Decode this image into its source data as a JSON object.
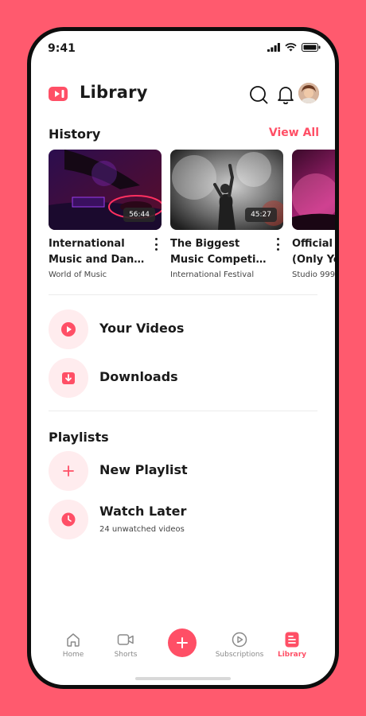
{
  "status_bar": {
    "time": "9:41"
  },
  "header": {
    "title": "Library"
  },
  "history": {
    "title": "History",
    "view_all": "View All",
    "videos": [
      {
        "title_line1": "International",
        "title_line2": "Music and Dance…",
        "channel": "World of Music",
        "duration": "56:44"
      },
      {
        "title_line1": "The Biggest",
        "title_line2": "Music Competiti…",
        "channel": "International Festival",
        "duration": "45:27"
      },
      {
        "title_line1": "Official",
        "title_line2": "(Only Yo",
        "channel": "Studio 999",
        "duration": ""
      }
    ]
  },
  "library_items": [
    {
      "label": "Your Videos",
      "icon": "play-icon"
    },
    {
      "label": "Downloads",
      "icon": "download-icon"
    }
  ],
  "playlists": {
    "title": "Playlists",
    "items": [
      {
        "label": "New Playlist",
        "icon": "plus-icon",
        "sub": ""
      },
      {
        "label": "Watch Later",
        "icon": "clock-icon",
        "sub": "24 unwatched videos"
      }
    ]
  },
  "tabbar": {
    "tabs": [
      {
        "label": "Home",
        "icon": "home-icon"
      },
      {
        "label": "Shorts",
        "icon": "camera-icon"
      },
      {
        "label": "Subscriptions",
        "icon": "subscriptions-icon"
      },
      {
        "label": "Library",
        "icon": "library-icon",
        "active": true
      }
    ]
  },
  "colors": {
    "accent": "#FF4F66",
    "background": "#FF5A6E",
    "icon_bg": "#FFECEE"
  }
}
